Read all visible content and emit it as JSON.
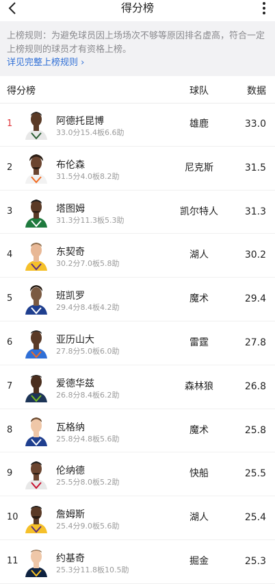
{
  "header": {
    "title": "得分榜",
    "back_icon": "chevron-left-icon",
    "more_icon": "more-vertical-icon"
  },
  "notice": {
    "text": "上榜规则：为避免球员因上场场次不够等原因排名虚高，符合一定上榜规则的球员才有资格上榜。",
    "link_label": "详见完整上榜规则 ›"
  },
  "table": {
    "col_title": "得分榜",
    "col_team": "球队",
    "col_data": "数据"
  },
  "colors": {
    "accent": "#2f6fd6",
    "top_rank": "#e0363c"
  },
  "players": [
    {
      "rank": "1",
      "name": "阿德托昆博",
      "stats": "33.0分15.4板6.6助",
      "team": "雄鹿",
      "value": "33.0"
    },
    {
      "rank": "2",
      "name": "布伦森",
      "stats": "31.5分4.0板8.2助",
      "team": "尼克斯",
      "value": "31.5"
    },
    {
      "rank": "3",
      "name": "塔图姆",
      "stats": "31.3分11.3板5.3助",
      "team": "凯尔特人",
      "value": "31.3"
    },
    {
      "rank": "4",
      "name": "东契奇",
      "stats": "30.2分7.0板5.8助",
      "team": "湖人",
      "value": "30.2"
    },
    {
      "rank": "5",
      "name": "班凯罗",
      "stats": "29.4分8.4板4.2助",
      "team": "魔术",
      "value": "29.4"
    },
    {
      "rank": "6",
      "name": "亚历山大",
      "stats": "27.8分5.0板6.0助",
      "team": "雷霆",
      "value": "27.8"
    },
    {
      "rank": "7",
      "name": "爱德华兹",
      "stats": "26.8分8.4板6.2助",
      "team": "森林狼",
      "value": "26.8"
    },
    {
      "rank": "8",
      "name": "瓦格纳",
      "stats": "25.8分4.8板5.6助",
      "team": "魔术",
      "value": "25.8"
    },
    {
      "rank": "9",
      "name": "伦纳德",
      "stats": "25.5分8.0板5.2助",
      "team": "快船",
      "value": "25.5"
    },
    {
      "rank": "10",
      "name": "詹姆斯",
      "stats": "25.4分9.0板5.6助",
      "team": "湖人",
      "value": "25.4"
    },
    {
      "rank": "11",
      "name": "约基奇",
      "stats": "25.3分11.8板10.5助",
      "team": "掘金",
      "value": "25.3"
    }
  ]
}
